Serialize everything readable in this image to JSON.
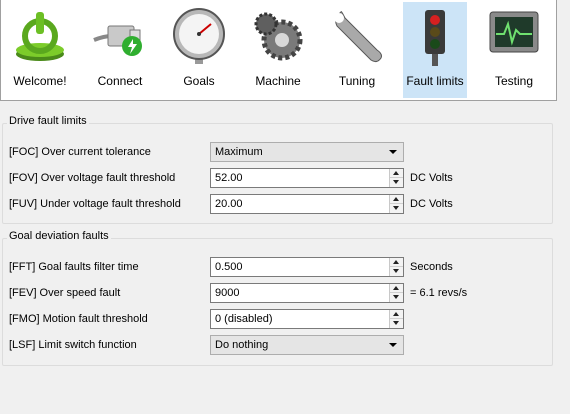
{
  "toolbar": {
    "items": [
      {
        "label": "Welcome!",
        "icon": "power-icon"
      },
      {
        "label": "Connect",
        "icon": "network-plug-icon"
      },
      {
        "label": "Goals",
        "icon": "gauge-icon"
      },
      {
        "label": "Machine",
        "icon": "gears-icon"
      },
      {
        "label": "Tuning",
        "icon": "wrench-icon"
      },
      {
        "label": "Fault limits",
        "icon": "traffic-light-icon",
        "active": true
      },
      {
        "label": "Testing",
        "icon": "oscilloscope-icon"
      }
    ]
  },
  "drive_fault_limits": {
    "title": "Drive fault limits",
    "foc": {
      "label": "[FOC] Over current tolerance",
      "value": "Maximum"
    },
    "fov": {
      "label": "[FOV] Over voltage fault threshold",
      "value": "52.00",
      "unit": "DC Volts"
    },
    "fuv": {
      "label": "[FUV] Under voltage fault threshold",
      "value": "20.00",
      "unit": "DC Volts"
    }
  },
  "goal_deviation_faults": {
    "title": "Goal deviation faults",
    "fft": {
      "label": "[FFT] Goal faults filter time",
      "value": "0.500",
      "unit": "Seconds"
    },
    "fev": {
      "label": "[FEV] Over speed fault",
      "value": "9000",
      "unit": "= 6.1 revs/s"
    },
    "fmo": {
      "label": "[FMO] Motion fault threshold",
      "value": "0 (disabled)"
    },
    "lsf": {
      "label": "[LSF] Limit switch function",
      "value": "Do nothing"
    }
  },
  "colors": {
    "active_tab_bg": "#cce4f7",
    "window_bg": "#f0f0f0"
  }
}
